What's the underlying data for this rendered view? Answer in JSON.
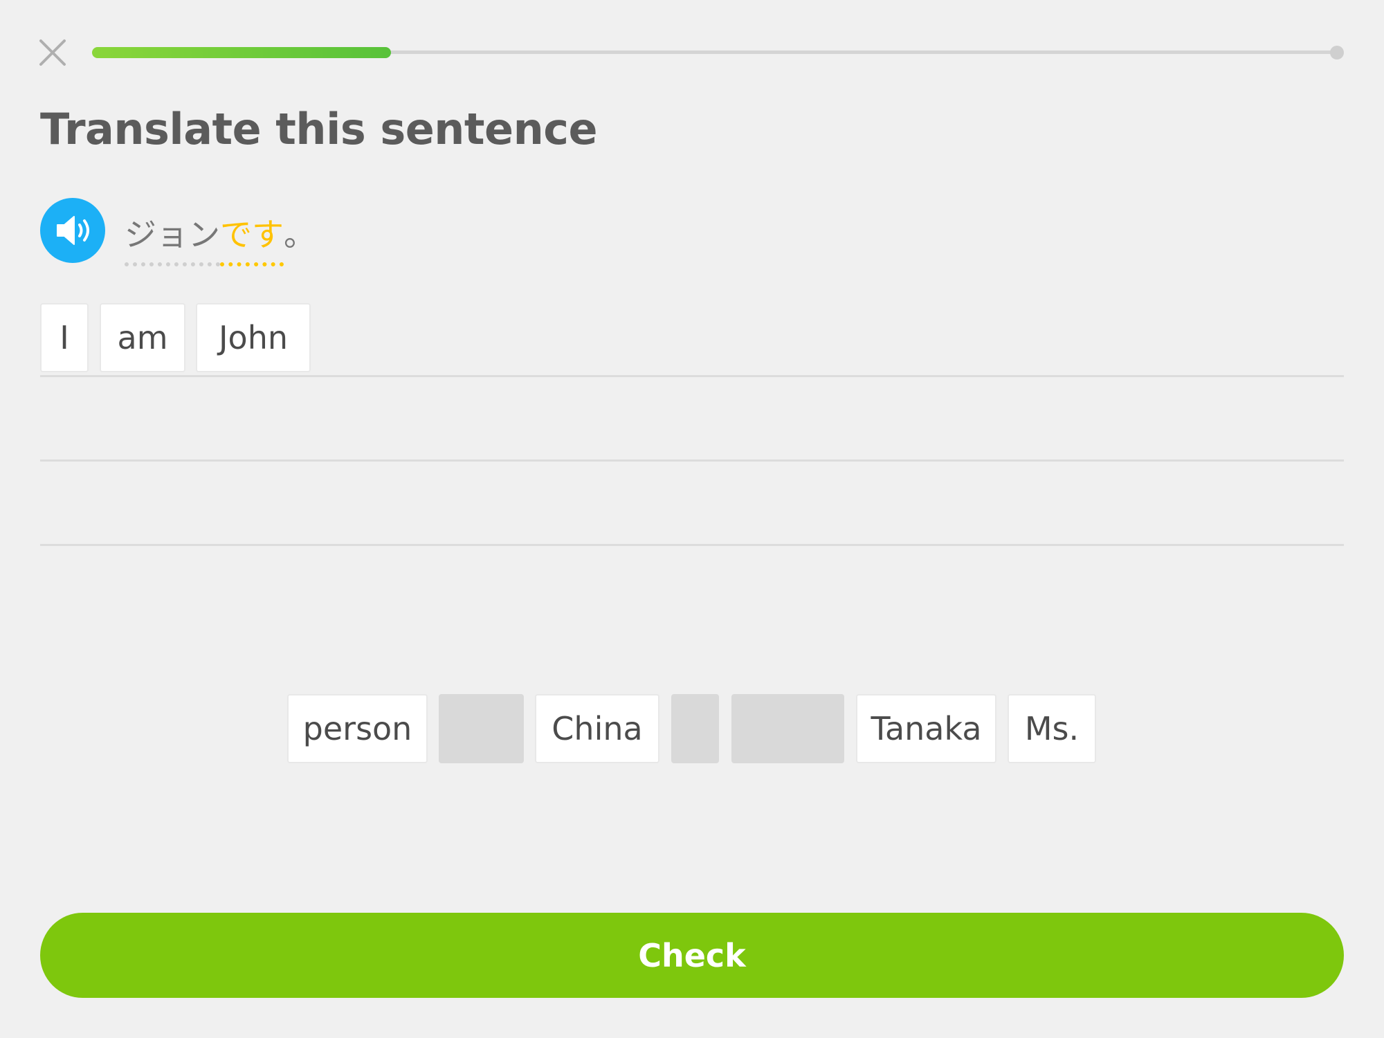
{
  "header": {
    "close_icon": "close-icon",
    "progress": 0.24
  },
  "instruction": {
    "title": "Translate this sentence"
  },
  "prompt": {
    "speaker_icon": "speaker-icon",
    "tokens": [
      {
        "text": "ジョン",
        "highlight": false
      },
      {
        "text": "です",
        "highlight": true
      },
      {
        "text": "。",
        "highlight": false
      }
    ]
  },
  "answer": {
    "selected_words": [
      "I",
      "am",
      "John"
    ]
  },
  "word_bank": {
    "items": [
      {
        "text": "person",
        "used": false
      },
      {
        "text": "",
        "used": true
      },
      {
        "text": "China",
        "used": false
      },
      {
        "text": "",
        "used": true
      },
      {
        "text": "",
        "used": true
      },
      {
        "text": "Tanaka",
        "used": false
      },
      {
        "text": "Ms.",
        "used": false
      }
    ]
  },
  "footer": {
    "check_label": "Check"
  },
  "colors": {
    "accent_blue": "#1cb0f6",
    "highlight_yellow": "#ffc200",
    "check_green": "#7ec70d",
    "progress_green": "#58c23a"
  }
}
